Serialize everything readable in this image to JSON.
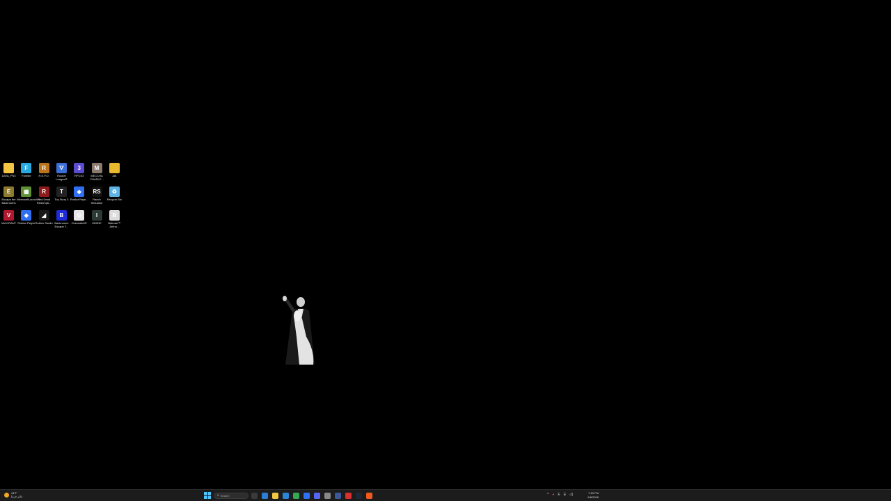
{
  "desktop": {
    "icons": [
      {
        "label": "DATA_PS3",
        "icon": "folder-icon",
        "color": "#f4c542",
        "glyph": ""
      },
      {
        "label": "Fortnite",
        "icon": "fortnite-icon",
        "color": "#29a8e0",
        "glyph": "F"
      },
      {
        "label": "R.E.P.O.",
        "icon": "repo-icon",
        "color": "#b9741c",
        "glyph": "R"
      },
      {
        "label": "Rocket League®",
        "icon": "rocket-league-icon",
        "color": "#3a6fd8",
        "glyph": "⛛"
      },
      {
        "label": "RPCS3",
        "icon": "rpcs3-icon",
        "color": "#5b4bd1",
        "glyph": "3"
      },
      {
        "label": "MECCHA CHARLE...",
        "icon": "meccha-charle-icon",
        "color": "#8a7a6e",
        "glyph": "M"
      },
      {
        "label": "Jdk",
        "icon": "folder-icon",
        "color": "#e8b82e",
        "glyph": ""
      },
      {
        "label": "Escape the Backrooms",
        "icon": "escape-backrooms-icon",
        "color": "#8c7a2e",
        "glyph": "E"
      },
      {
        "label": "MinecraftLauncher",
        "icon": "minecraft-icon",
        "color": "#5e8f32",
        "glyph": "▦"
      },
      {
        "label": "Red Dead Redempti...",
        "icon": "red-dead-icon",
        "color": "#8e1b1b",
        "glyph": "R"
      },
      {
        "label": "Toy Story 3",
        "icon": "toy-story-icon",
        "color": "#222222",
        "glyph": "T"
      },
      {
        "label": "RobloxPlaye...",
        "icon": "roblox-icon",
        "color": "#2f6ff2",
        "glyph": "◆"
      },
      {
        "label": "Ranch Simulator",
        "icon": "ranch-simulator-icon",
        "color": "#111111",
        "glyph": "RS"
      },
      {
        "label": "Recycle Bin",
        "icon": "recycle-bin-icon",
        "color": "#5fb4e6",
        "glyph": "♻"
      },
      {
        "label": "VALORANT",
        "icon": "valorant-icon",
        "color": "#b0192f",
        "glyph": "V"
      },
      {
        "label": "Roblox Player",
        "icon": "roblox-player-icon",
        "color": "#2f6ff2",
        "glyph": "◆"
      },
      {
        "label": "Roblox Studio",
        "icon": "roblox-studio-icon",
        "color": "#1a1a1a",
        "glyph": "◢"
      },
      {
        "label": "Backrooms Escape T...",
        "icon": "backrooms-escape-icon",
        "color": "#1e2bd6",
        "glyph": "B"
      },
      {
        "label": "Overwatch®",
        "icon": "overwatch-icon",
        "color": "#e7e7e7",
        "glyph": "⊙"
      },
      {
        "label": "INSIDE",
        "icon": "inside-icon",
        "color": "#2c3a36",
        "glyph": "I"
      },
      {
        "label": "Batman™ Arkha...",
        "icon": "batman-icon",
        "color": "#dcdcdc",
        "glyph": "B"
      }
    ]
  },
  "taskbar": {
    "weather_temp": "44°F",
    "weather_desc": "غائم جزئيا",
    "search_placeholder": "Search",
    "apps": [
      {
        "icon": "task-view-icon",
        "color": "#3a3a3a"
      },
      {
        "icon": "widgets-icon",
        "color": "#2d7dd2"
      },
      {
        "icon": "file-explorer-icon",
        "color": "#f2c744"
      },
      {
        "icon": "store-icon",
        "color": "#2a86d6"
      },
      {
        "icon": "chrome-icon",
        "color": "#34a853"
      },
      {
        "icon": "roblox-taskbar-icon",
        "color": "#2f6ff2"
      },
      {
        "icon": "discord-icon",
        "color": "#5865f2"
      },
      {
        "icon": "settings-icon",
        "color": "#888888"
      },
      {
        "icon": "app-icon",
        "color": "#3b5998"
      },
      {
        "icon": "opera-icon",
        "color": "#d82f2f"
      },
      {
        "icon": "steam-icon",
        "color": "#1b2838"
      },
      {
        "icon": "brave-icon",
        "color": "#f25a1d"
      }
    ],
    "clock_time": "7:15 PM",
    "clock_date": "8/8/2026"
  }
}
